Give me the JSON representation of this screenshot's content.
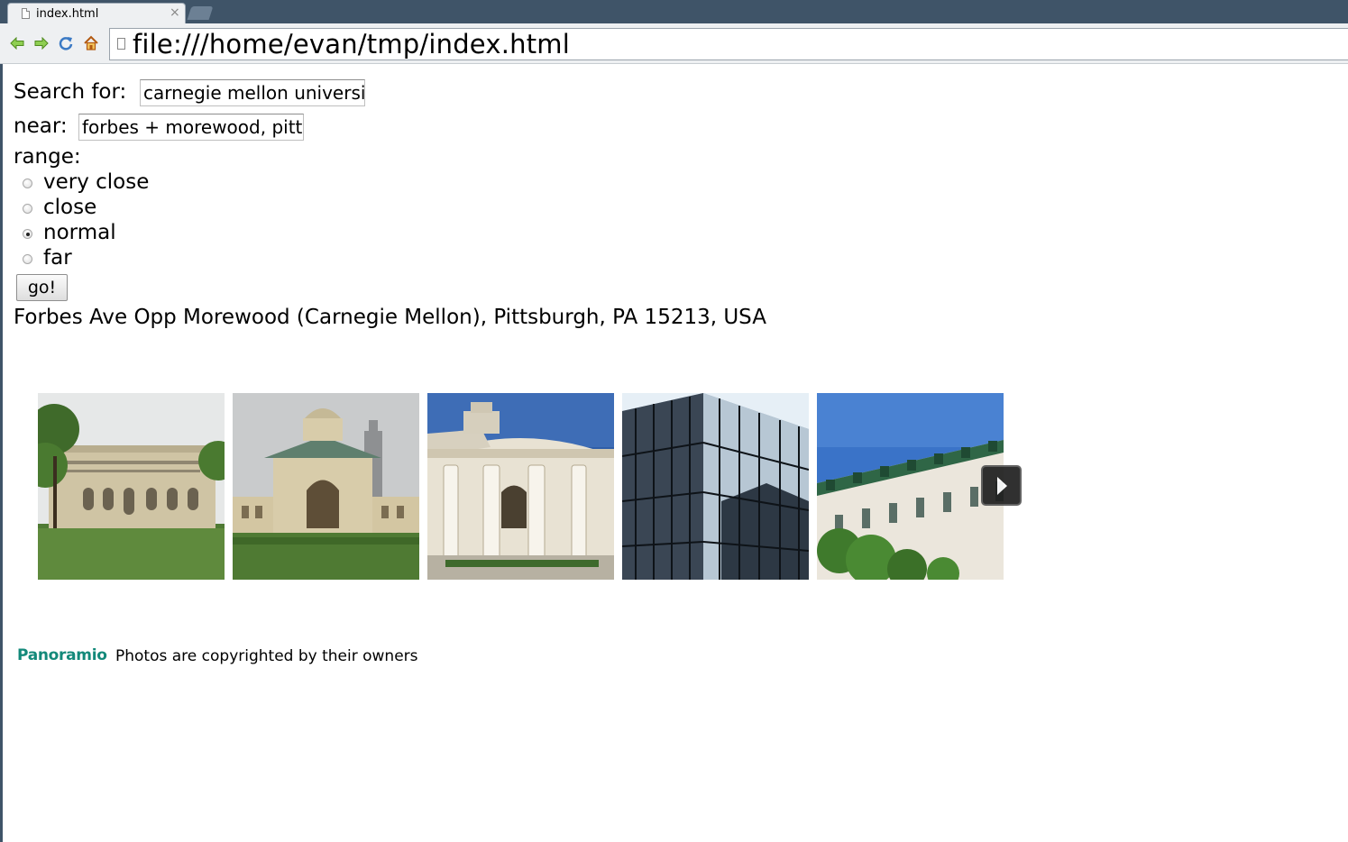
{
  "browser": {
    "tab_title": "index.html",
    "tab_close": "×",
    "url": "file:///home/evan/tmp/index.html"
  },
  "form": {
    "search_label": "Search for:",
    "search_value": "carnegie mellon universi",
    "near_label": "near:",
    "near_value": "forbes + morewood, pitt",
    "range_label": "range:",
    "range_options": [
      {
        "label": "very close",
        "checked": false
      },
      {
        "label": "close",
        "checked": false
      },
      {
        "label": "normal",
        "checked": true
      },
      {
        "label": "far",
        "checked": false
      }
    ],
    "go_label": "go!"
  },
  "result": {
    "address": "Forbes Ave Opp Morewood (Carnegie Mellon), Pittsburgh, PA 15213, USA"
  },
  "photos": {
    "count_visible": 5
  },
  "footer": {
    "logo_text": "Panoramio",
    "copyright": "Photos are copyrighted by their owners"
  },
  "colors": {
    "tabstrip": "#3f5468",
    "logo": "#13897a"
  }
}
